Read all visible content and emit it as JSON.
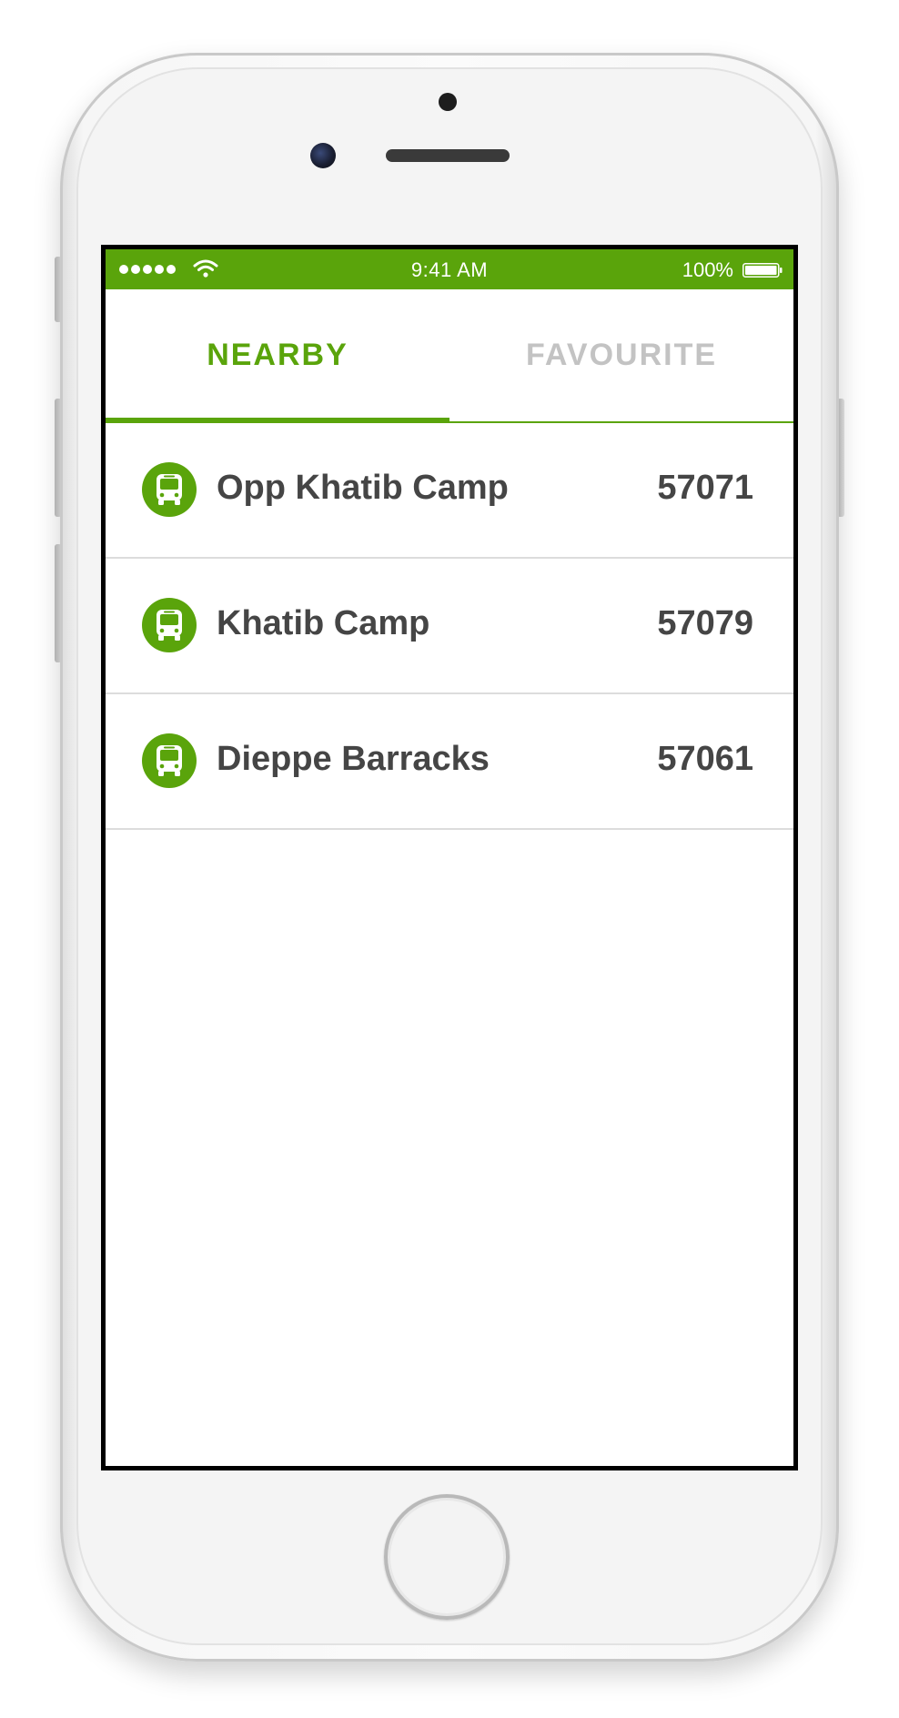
{
  "status_bar": {
    "time": "9:41 AM",
    "battery": "100%",
    "signal_icon": "signal-dots-icon",
    "wifi_icon": "wifi-icon",
    "battery_icon": "battery-icon"
  },
  "tabs": [
    {
      "label": "NEARBY",
      "active": true
    },
    {
      "label": "FAVOURITE",
      "active": false
    }
  ],
  "stops": [
    {
      "name": "Opp Khatib Camp",
      "code": "57071",
      "icon": "bus-icon"
    },
    {
      "name": "Khatib Camp",
      "code": "57079",
      "icon": "bus-icon"
    },
    {
      "name": "Dieppe Barracks",
      "code": "57061",
      "icon": "bus-icon"
    }
  ],
  "colors": {
    "accent": "#5aa40b",
    "inactive_tab": "#c3c3c3",
    "text": "#454545",
    "divider": "#dcdcdc"
  }
}
